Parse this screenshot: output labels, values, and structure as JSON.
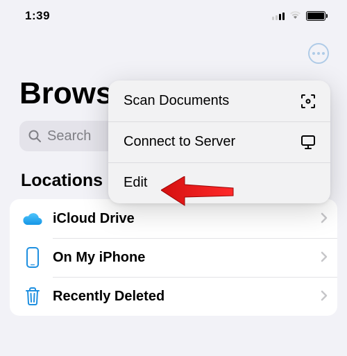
{
  "status": {
    "time": "1:39"
  },
  "header": {
    "title": "Browse"
  },
  "search": {
    "placeholder": "Search"
  },
  "section": {
    "locations_title": "Locations"
  },
  "locations": [
    {
      "label": "iCloud Drive"
    },
    {
      "label": "On My iPhone"
    },
    {
      "label": "Recently Deleted"
    }
  ],
  "menu": {
    "scan": "Scan Documents",
    "connect": "Connect to Server",
    "edit": "Edit"
  }
}
